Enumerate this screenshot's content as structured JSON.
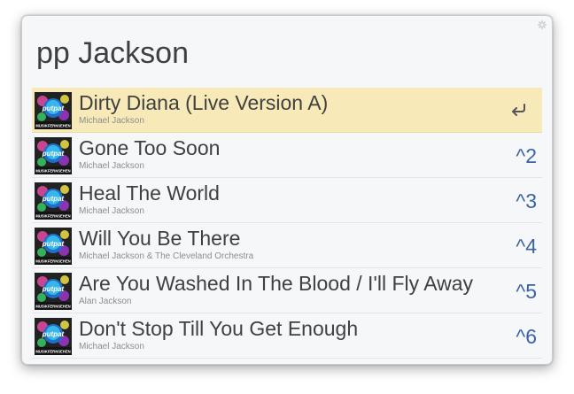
{
  "query": "pp Jackson",
  "colors": {
    "accent": "#3a63a7",
    "selected_row": "#f8eab8"
  },
  "results": [
    {
      "title": "Dirty Diana (Live Version A)",
      "subtitle": "Michael Jackson",
      "shortcut": "",
      "shortcut_icon": "return-icon",
      "selected": true,
      "thumbnail": {
        "text_top": "putpat",
        "text_bottom": "MUSIKFERNSEHEN"
      }
    },
    {
      "title": "Gone Too Soon",
      "subtitle": "Michael Jackson",
      "shortcut": "^2",
      "selected": false,
      "thumbnail": {
        "text_top": "putpat",
        "text_bottom": "MUSIKFERNSEHEN"
      }
    },
    {
      "title": "Heal The World",
      "subtitle": "Michael Jackson",
      "shortcut": "^3",
      "selected": false,
      "thumbnail": {
        "text_top": "putpat",
        "text_bottom": "MUSIKFERNSEHEN"
      }
    },
    {
      "title": "Will You Be There",
      "subtitle": "Michael Jackson & The Cleveland Orchestra",
      "shortcut": "^4",
      "selected": false,
      "thumbnail": {
        "text_top": "putpat",
        "text_bottom": "MUSIKFERNSEHEN"
      }
    },
    {
      "title": "Are You Washed In The Blood / I'll Fly Away",
      "subtitle": "Alan Jackson",
      "shortcut": "^5",
      "selected": false,
      "thumbnail": {
        "text_top": "putpat",
        "text_bottom": "MUSIKFERNSEHEN"
      }
    },
    {
      "title": "Don't Stop Till You Get Enough",
      "subtitle": "Michael Jackson",
      "shortcut": "^6",
      "selected": false,
      "thumbnail": {
        "text_top": "putpat",
        "text_bottom": "MUSIKFERNSEHEN"
      }
    }
  ]
}
